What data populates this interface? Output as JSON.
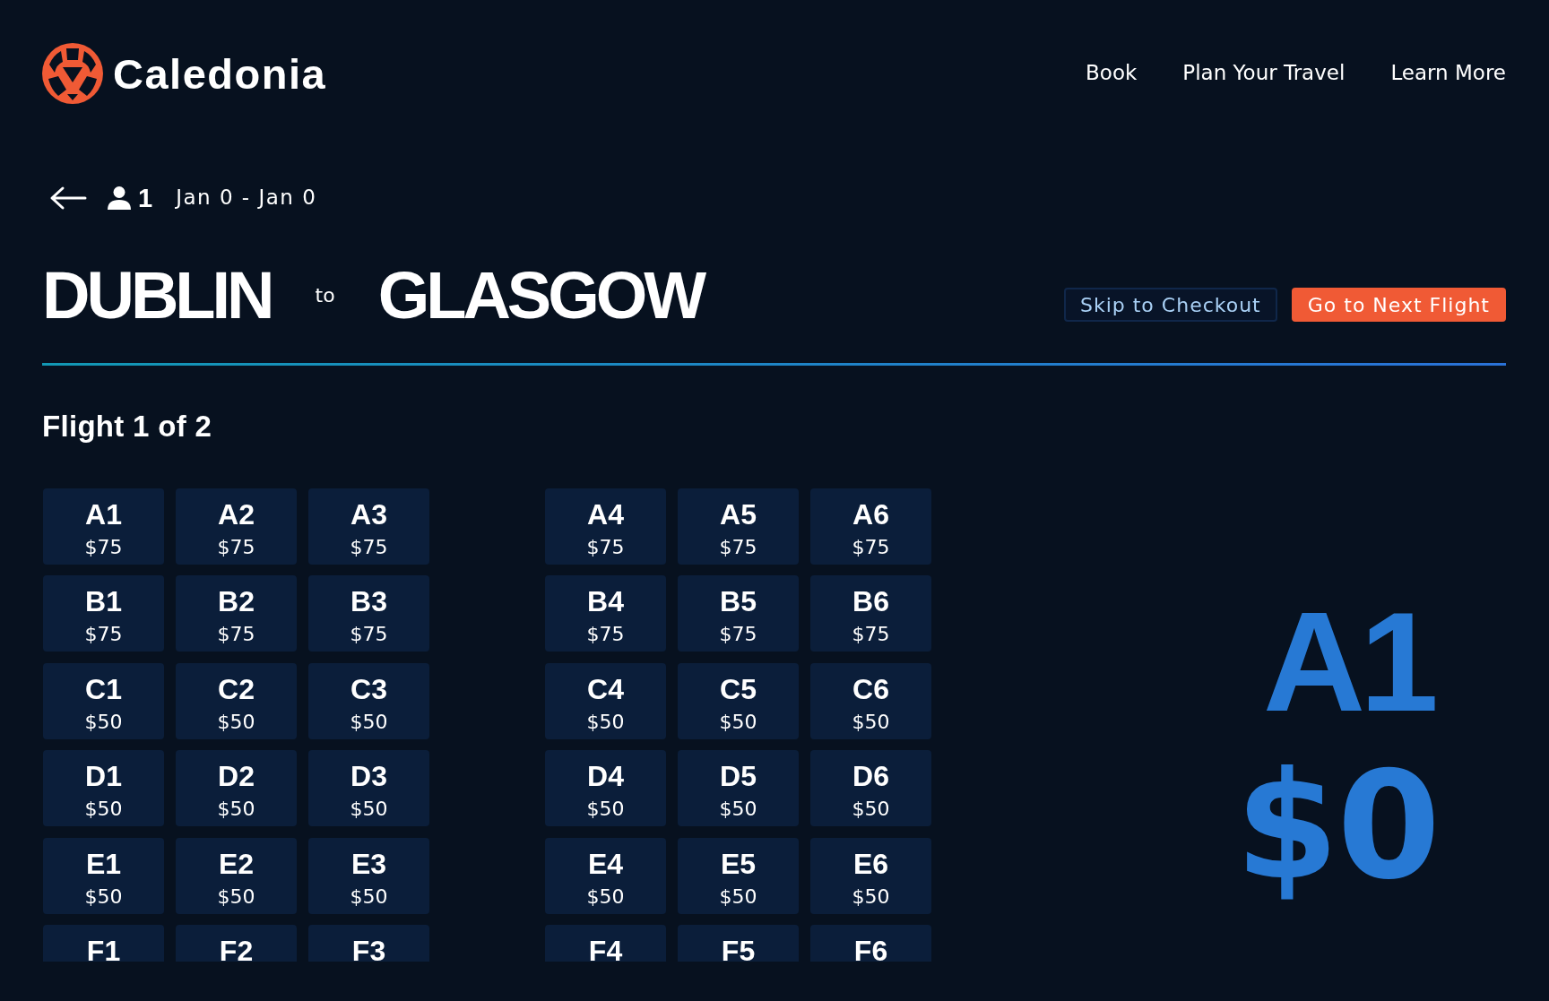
{
  "brand": {
    "name": "Caledonia"
  },
  "nav": [
    {
      "label": "Book"
    },
    {
      "label": "Plan Your Travel"
    },
    {
      "label": "Learn More"
    }
  ],
  "trip": {
    "passengers": "1",
    "dates": "Jan 0 - Jan 0"
  },
  "route": {
    "origin": "DUBLIN",
    "connector": "to",
    "destination": "GLASGOW"
  },
  "actions": [
    {
      "label": "Skip to Checkout",
      "kind": "secondary"
    },
    {
      "label": "Go to Next Flight",
      "kind": "primary"
    }
  ],
  "flight_heading": "Flight 1 of 2",
  "seat_blocks": [
    {
      "rows": [
        {
          "seats": [
            {
              "label": "A1",
              "price": "$75"
            },
            {
              "label": "A2",
              "price": "$75"
            },
            {
              "label": "A3",
              "price": "$75"
            }
          ]
        },
        {
          "seats": [
            {
              "label": "B1",
              "price": "$75"
            },
            {
              "label": "B2",
              "price": "$75"
            },
            {
              "label": "B3",
              "price": "$75"
            }
          ]
        },
        {
          "seats": [
            {
              "label": "C1",
              "price": "$50"
            },
            {
              "label": "C2",
              "price": "$50"
            },
            {
              "label": "C3",
              "price": "$50"
            }
          ]
        },
        {
          "seats": [
            {
              "label": "D1",
              "price": "$50"
            },
            {
              "label": "D2",
              "price": "$50"
            },
            {
              "label": "D3",
              "price": "$50"
            }
          ]
        },
        {
          "seats": [
            {
              "label": "E1",
              "price": "$50"
            },
            {
              "label": "E2",
              "price": "$50"
            },
            {
              "label": "E3",
              "price": "$50"
            }
          ]
        },
        {
          "seats": [
            {
              "label": "F1"
            },
            {
              "label": "F2"
            },
            {
              "label": "F3"
            }
          ]
        }
      ]
    },
    {
      "rows": [
        {
          "seats": [
            {
              "label": "A4",
              "price": "$75"
            },
            {
              "label": "A5",
              "price": "$75"
            },
            {
              "label": "A6",
              "price": "$75"
            }
          ]
        },
        {
          "seats": [
            {
              "label": "B4",
              "price": "$75"
            },
            {
              "label": "B5",
              "price": "$75"
            },
            {
              "label": "B6",
              "price": "$75"
            }
          ]
        },
        {
          "seats": [
            {
              "label": "C4",
              "price": "$50"
            },
            {
              "label": "C5",
              "price": "$50"
            },
            {
              "label": "C6",
              "price": "$50"
            }
          ]
        },
        {
          "seats": [
            {
              "label": "D4",
              "price": "$50"
            },
            {
              "label": "D5",
              "price": "$50"
            },
            {
              "label": "D6",
              "price": "$50"
            }
          ]
        },
        {
          "seats": [
            {
              "label": "E4",
              "price": "$50"
            },
            {
              "label": "E5",
              "price": "$50"
            },
            {
              "label": "E6",
              "price": "$50"
            }
          ]
        },
        {
          "seats": [
            {
              "label": "F4"
            },
            {
              "label": "F5"
            },
            {
              "label": "F6"
            }
          ]
        }
      ]
    }
  ],
  "selection": {
    "seat": "A1",
    "price": "$0"
  }
}
